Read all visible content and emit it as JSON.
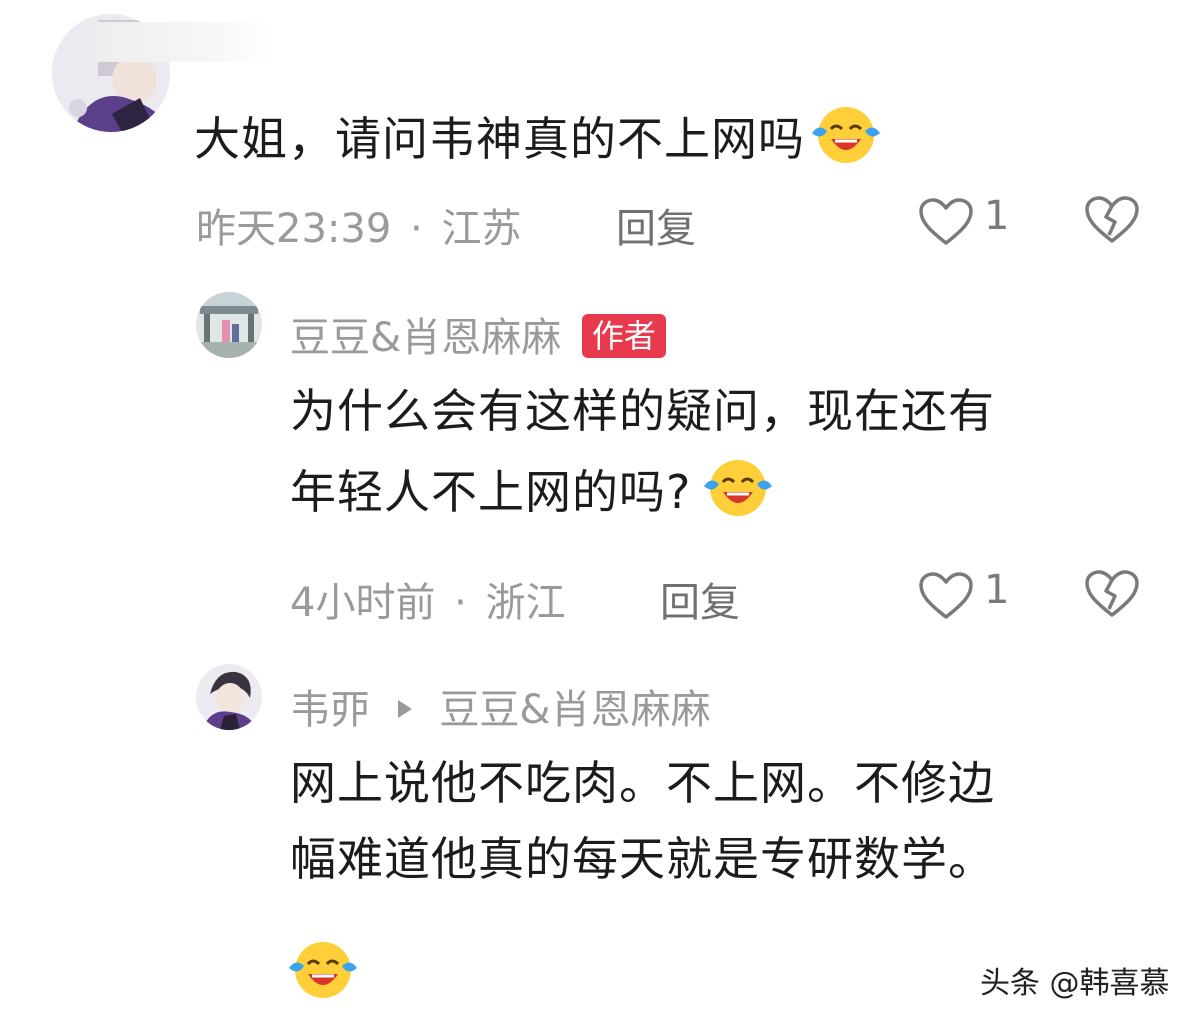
{
  "comments": [
    {
      "text": "大姐，请问韦神真的不上网吗",
      "time": "昨天23:39",
      "sep": "·",
      "location": "江苏",
      "reply_label": "回复",
      "likes": "1"
    },
    {
      "author": "豆豆&肖恩麻麻",
      "badge": "作者",
      "line1": "为什么会有这样的疑问，现在还有",
      "line2": "年轻人不上网的吗?",
      "time": "4小时前",
      "sep": "·",
      "location": "浙江",
      "reply_label": "回复",
      "likes": "1"
    },
    {
      "author": "韦丣",
      "reply_to": "豆豆&肖恩麻麻",
      "line1": "网上说他不吃肉。不上网。不修边",
      "line2": "幅难道他真的每天就是专研数学。"
    }
  ],
  "watermark": "头条 @韩喜慕",
  "icons": {
    "emoji": "laughing-crying-emoji",
    "like": "heart-outline-icon",
    "dislike": "broken-heart-icon",
    "reply_arrow": "triangle-right-icon"
  },
  "colors": {
    "badge": "#e8394f",
    "meta": "#9a9a9a",
    "emoji_face": "#ffcf3a",
    "emoji_tear": "#3aa2ee"
  }
}
